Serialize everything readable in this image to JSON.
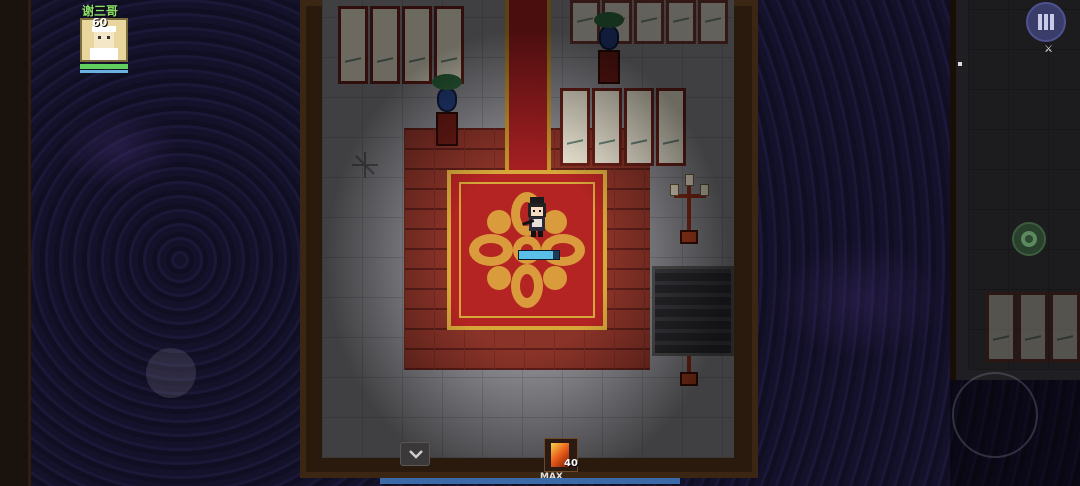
{
  "hud": {
    "player_name": "谢三哥",
    "level": "60",
    "hp_ratio": 1.0,
    "mp_ratio": 1.0
  },
  "player": {
    "hp_ratio": 0.85
  },
  "weapon": {
    "count": "40",
    "status": "MAX"
  },
  "icons": {
    "menu": "grid-menu-icon",
    "collapse": "chevron-down-icon",
    "skill": "skill-icon",
    "weapon": "fire-weapon-icon"
  },
  "colors": {
    "rug": "#b32422",
    "rug_trim": "#d6a83a",
    "hp": "#5fd05f",
    "mp": "#6ab0e0"
  }
}
